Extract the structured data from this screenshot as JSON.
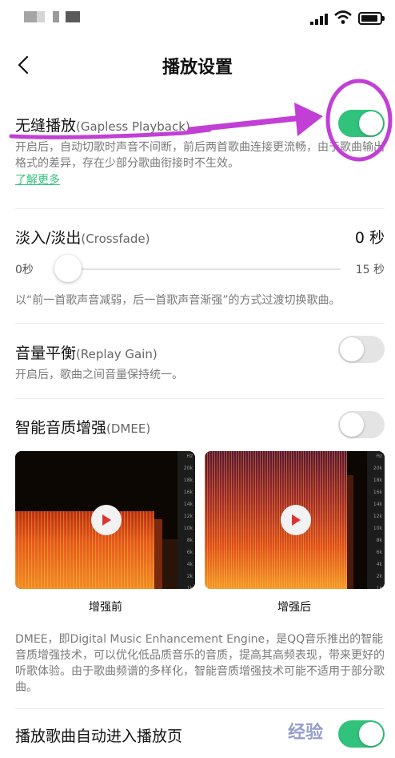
{
  "header": {
    "title": "播放设置"
  },
  "gapless": {
    "title": "无缝播放",
    "subtitle": "(Gapless Playback)",
    "description": "开启后，自动切歌时声音不间断，前后两首歌曲连接更流畅，由于歌曲输出格式的差异，存在少部分歌曲衔接时不生效。",
    "link": "了解更多",
    "enabled": true
  },
  "crossfade": {
    "title": "淡入/淡出",
    "subtitle": "(Crossfade)",
    "value_text": "0 秒",
    "slider_min": "0秒",
    "slider_max": "15 秒",
    "slider_value": 0,
    "description": "以“前一首歌声音减弱，后一首歌声音渐强”的方式过渡切换歌曲。"
  },
  "replay_gain": {
    "title": "音量平衡",
    "subtitle": "(Replay Gain)",
    "description": "开启后，歌曲之间音量保持统一。",
    "enabled": false
  },
  "dmee": {
    "title": "智能音质增强",
    "subtitle": "(DMEE)",
    "enabled": false,
    "axis_labels": [
      "Hz",
      "20k",
      "18k",
      "16k",
      "14k",
      "12k",
      "10k",
      "8k",
      "6k",
      "4k",
      "2k",
      "1k"
    ],
    "before_label": "增强前",
    "after_label": "增强后",
    "description": "DMEE，即Digital Music Enhancement Engine，是QQ音乐推出的智能音质增强技术，可以优化低品质音乐的音质，提高其高频表现，带来更好的听歌体验。由于歌曲频谱的多样化，智能音质增强技术可能不适用于部分歌曲。"
  },
  "auto_player": {
    "title": "播放歌曲自动进入播放页",
    "enabled": true
  },
  "watermark": "经验",
  "colors": {
    "accent": "#31c27c",
    "annotation": "#c23fd6"
  }
}
